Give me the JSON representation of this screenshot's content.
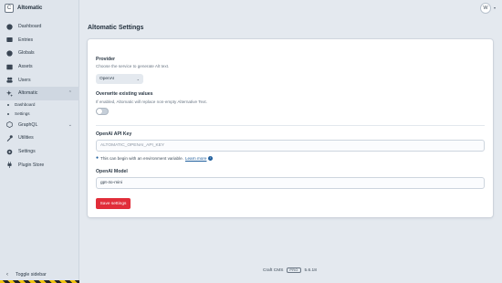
{
  "site": {
    "logo_letter": "C",
    "name": "Altomatic"
  },
  "nav": {
    "dashboard": "Dashboard",
    "entries": "Entries",
    "globals": "Globals",
    "assets": "Assets",
    "users": "Users",
    "altomatic": "Altomatic",
    "graphql": "GraphQL",
    "utilities": "Utilities",
    "settings": "Settings",
    "plugin_store": "Plugin Store"
  },
  "subnav": {
    "dashboard": "Dashboard",
    "settings": "Settings"
  },
  "toggle_sidebar": "Toggle sidebar",
  "user": {
    "avatar_letter": "W"
  },
  "page": {
    "title": "Altomatic Settings"
  },
  "form": {
    "provider": {
      "label": "Provider",
      "help": "Choose the service to generate Alt text.",
      "value": "OpenAI"
    },
    "overwrite": {
      "label": "Overwrite existing values",
      "help": "If enabled, Altomatic will replace non-empty Alternative Text."
    },
    "api_key": {
      "label": "OpenAI API Key",
      "value": "ALTOMATIC_OPENAI_API_KEY",
      "tip": "This can begin with an environment variable.",
      "learn_more": "Learn more"
    },
    "model": {
      "label": "OpenAI Model",
      "value": "gpt-4o-mini"
    },
    "save_label": "Save settings"
  },
  "footer": {
    "product": "Craft CMS",
    "edition": "PRO",
    "version": "5.6.18"
  },
  "colors": {
    "accent": "#e12d39",
    "link": "#1d5d9c"
  }
}
